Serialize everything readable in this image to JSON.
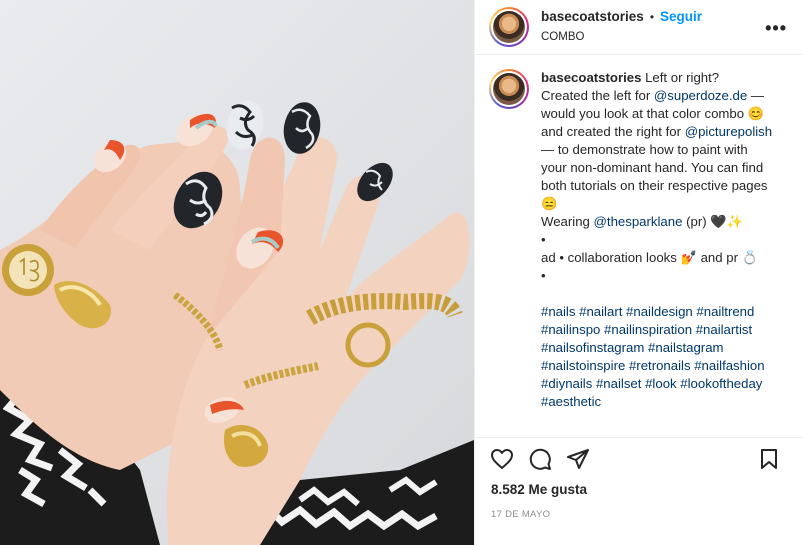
{
  "header": {
    "username": "basecoatstories",
    "separator": "•",
    "follow_label": "Seguir",
    "subtitle": "COMBO",
    "more_icon": "more-horizontal-icon"
  },
  "caption": {
    "username": "basecoatstories",
    "lines": {
      "l1": " Left or right?",
      "l2a": "Created the left for ",
      "l2b": "@superdoze.de",
      "l2c": " —",
      "l3": "would you look at that color combo 😊",
      "l4a": "and created the right for ",
      "l4b": "@picturepolish",
      "l5": "— to demonstrate how to paint with",
      "l6": "your non-dominant hand. You can find",
      "l7": "both tutorials on their respective pages",
      "l8": "😑",
      "l9a": "Wearing ",
      "l9b": "@thesparklane",
      "l9c": " (pr) 🖤✨",
      "l10": "•",
      "l11": "ad • collaboration looks 💅 and pr 💍",
      "l12": "•"
    },
    "hashtags": [
      "#nails #nailart #naildesign #nailtrend",
      "#nailinspo #nailinspiration #nailartist",
      "#nailsofinstagram #nailstagram",
      "#nailstoinspire #retronails #nailfashion",
      "#diynails #nailset #look #lookoftheday",
      "#aesthetic"
    ]
  },
  "actions": {
    "like_icon": "heart-icon",
    "comment_icon": "comment-icon",
    "share_icon": "paper-plane-icon",
    "save_icon": "bookmark-icon"
  },
  "likes": "8.582 Me gusta",
  "date": "17 DE MAYO",
  "colors": {
    "link": "#00376b",
    "follow": "#0095f6",
    "text": "#262626",
    "muted": "#8e8e8e"
  }
}
